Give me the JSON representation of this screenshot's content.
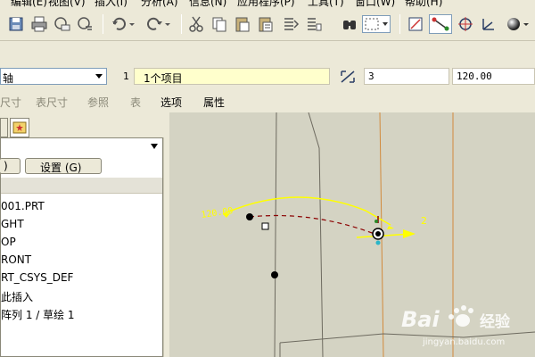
{
  "menu": {
    "items": [
      "编辑(E)",
      "视图(V)",
      "插入(I)",
      "分析(A)",
      "信息(N)",
      "应用程序(P)",
      "工具(T)",
      "窗口(W)",
      "帮助(H)"
    ]
  },
  "dashboard": {
    "axis_label": "轴",
    "ref_index": "1",
    "ref_value": "1个项目",
    "field_value_1": "3",
    "field_value_2": "120.00"
  },
  "tabs": {
    "items": [
      "尺寸",
      "表尺寸",
      "参照",
      "表",
      "选项",
      "属性"
    ]
  },
  "left_panel": {
    "button_1_label": ")",
    "button_2_label": "设置 (G)",
    "tree_items": [
      "001.PRT",
      "GHT",
      "OP",
      "RONT",
      "RT_CSYS_DEF",
      "此插入",
      "阵列 1 / 草绘 1"
    ]
  },
  "viewport": {
    "angle_label": "120.00",
    "count_label": "2"
  },
  "watermark": {
    "brand": "Bai",
    "brand_suffix": "经验",
    "url": "jingyan.baidu.com"
  },
  "colors": {
    "accent": "#ffff00",
    "viewport_bg": "#d4d3c3",
    "dimension_red": "#8b0000"
  }
}
